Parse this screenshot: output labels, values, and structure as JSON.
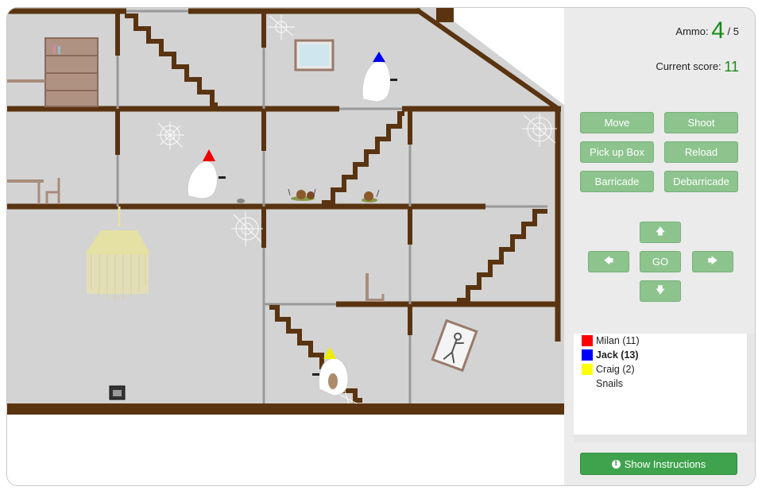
{
  "ammo": {
    "label": "Ammo:",
    "current": "4",
    "max": "/ 5"
  },
  "score": {
    "label": "Current score:",
    "value": "11"
  },
  "actions": {
    "move": "Move",
    "shoot": "Shoot",
    "pickup": "Pick up Box",
    "reload": "Reload",
    "barricade": "Barricade",
    "debarricade": "Debarricade"
  },
  "dpad": {
    "up": "🡅",
    "left": "🡄",
    "go": "GO",
    "right": "🡆",
    "down": "🡇"
  },
  "players": [
    {
      "name": "Milan (11)",
      "color": "#ff0000",
      "bold": false
    },
    {
      "name": "Jack (13)",
      "color": "#0000ff",
      "bold": true
    },
    {
      "name": "Craig (2)",
      "color": "#ffff00",
      "bold": false
    },
    {
      "name": "Snails",
      "color": "",
      "bold": false
    }
  ],
  "instructions": {
    "icon": "i",
    "label": "Show Instructions"
  },
  "colors": {
    "wall": "#5a3410",
    "accent": "#1a8a1a",
    "button": "#8dc48e",
    "instructions": "#3fa34d"
  }
}
